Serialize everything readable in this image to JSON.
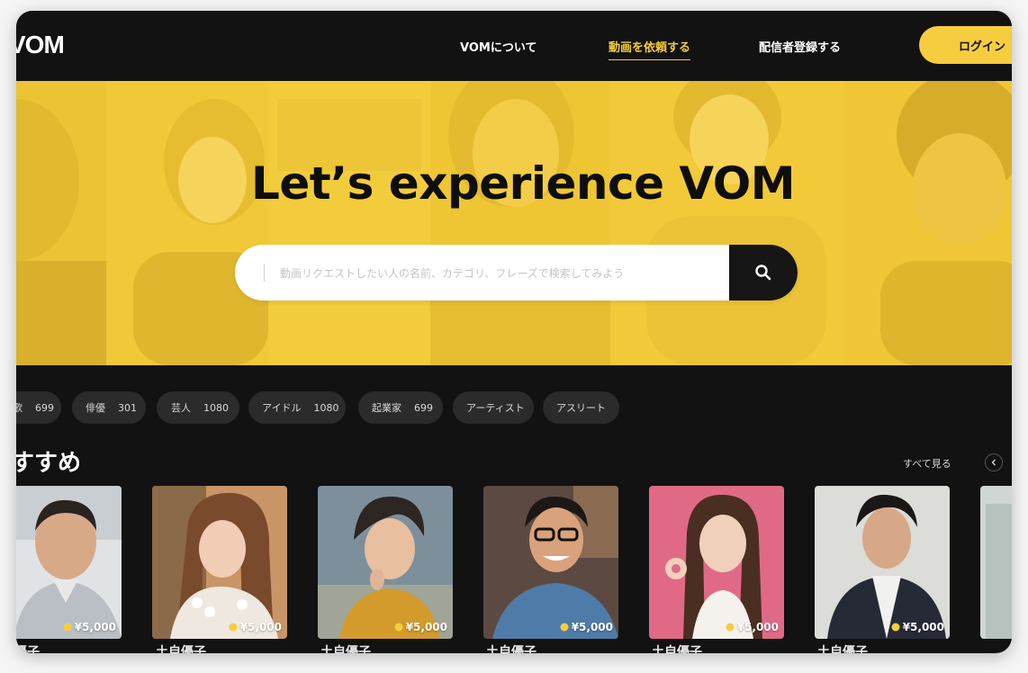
{
  "header": {
    "logo": "VOM",
    "nav": [
      {
        "label": "VOMについて"
      },
      {
        "label": "動画を依頼する"
      },
      {
        "label": "配信者登録する"
      }
    ],
    "login_label": "ログイン"
  },
  "hero": {
    "title": "Let’s experience VOM",
    "search_placeholder": "動画リクエストしたい人の名前、カテゴリ、フレーズで検索してみよう",
    "search_value": ""
  },
  "categories": [
    {
      "label": "歌",
      "count": "699"
    },
    {
      "label": "俳優",
      "count": "301"
    },
    {
      "label": "芸人",
      "count": "1080"
    },
    {
      "label": "アイドル",
      "count": "1080"
    },
    {
      "label": "起業家",
      "count": "699"
    },
    {
      "label": "アーティスト",
      "count": ""
    },
    {
      "label": "アスリート",
      "count": ""
    }
  ],
  "section": {
    "title": "すすめ",
    "see_all_label": "すべて見る"
  },
  "cards": [
    {
      "price": "¥5,000",
      "name": "土自優子"
    },
    {
      "price": "¥5,000",
      "name": "土自優子"
    },
    {
      "price": "¥5,000",
      "name": "土自優子"
    },
    {
      "price": "¥5,000",
      "name": "土自優子"
    },
    {
      "price": "¥5,000",
      "name": "土自優子"
    },
    {
      "price": "¥5,000",
      "name": "土自優子"
    }
  ],
  "colors": {
    "accent": "#f5cd3e",
    "background": "#121212",
    "chip": "#2b2b2b"
  }
}
